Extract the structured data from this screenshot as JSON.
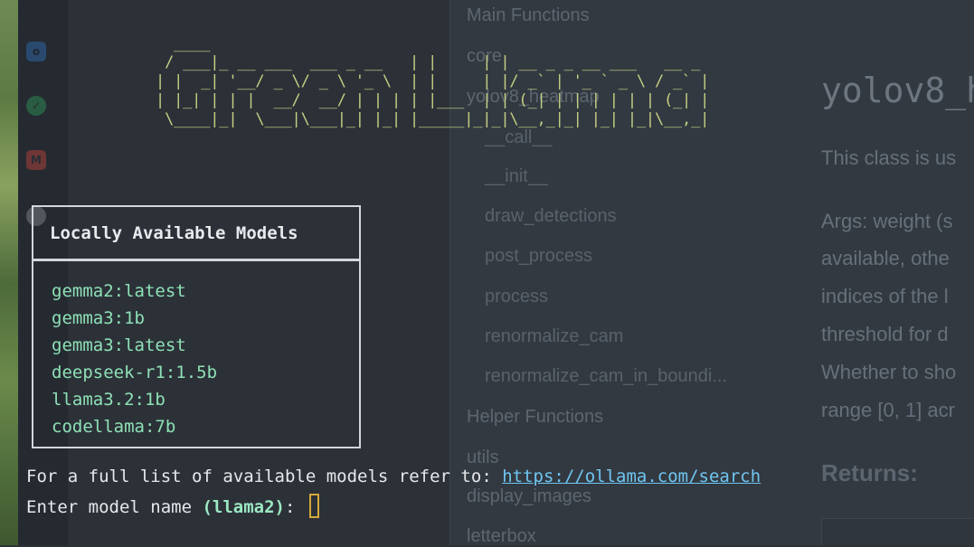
{
  "banner": {
    "ascii": "   ____\n  / ___|_ __ ___  ___ _ __   | |     | | __ _ _ __ ___   __ _\n | |  _| '__/ _ \\/ _ \\ '_ \\  | |     | |/ _` | '_ ` _ \\ / _` |\n | |_| | | |  __/  __/ | | | | |___  | | (_| | | | | | | (_| |\n  \\____|_|  \\___|\\___|_| |_| |_____|_|_|\\__,_|_| |_| |_|\\__,_|"
  },
  "models_box": {
    "header": "Locally Available Models",
    "models": [
      "gemma2:latest",
      "gemma3:1b",
      "gemma3:latest",
      "deepseek-r1:1.5b",
      "llama3.2:1b",
      "codellama:7b"
    ]
  },
  "terminal": {
    "info_prefix": "For a full list of available models refer to: ",
    "info_link": "https://ollama.com/search",
    "prompt_prefix": "Enter model name ",
    "prompt_default": "(llama2)",
    "prompt_suffix": ": "
  },
  "docs_nav": {
    "main_functions": "Main Functions",
    "core": "core",
    "class_item": "yolov8_heatmap",
    "members": [
      "__call__",
      "__init__",
      "draw_detections",
      "post_process",
      "process",
      "renormalize_cam",
      "renormalize_cam_in_boundi..."
    ],
    "helper_functions": "Helper Functions",
    "utils": "utils",
    "helpers": [
      "display_images",
      "letterbox"
    ]
  },
  "docs_content": {
    "title": "yolov8_h",
    "lines": [
      "This class is us",
      "Args: weight (s",
      "available, othe",
      "indices of the l",
      "threshold for d",
      "Whether to sho",
      "range [0, 1] acr"
    ],
    "returns": "Returns:"
  },
  "dock_icons": [
    "outlook-icon",
    "chat-icon",
    "gmail-icon",
    "app-icon"
  ],
  "colors": {
    "terminal_bg": "#2c3138",
    "banner": "#c4cf82",
    "model_text": "#8ee0b6",
    "link": "#6fc6f2",
    "cursor": "#d4a93a"
  }
}
